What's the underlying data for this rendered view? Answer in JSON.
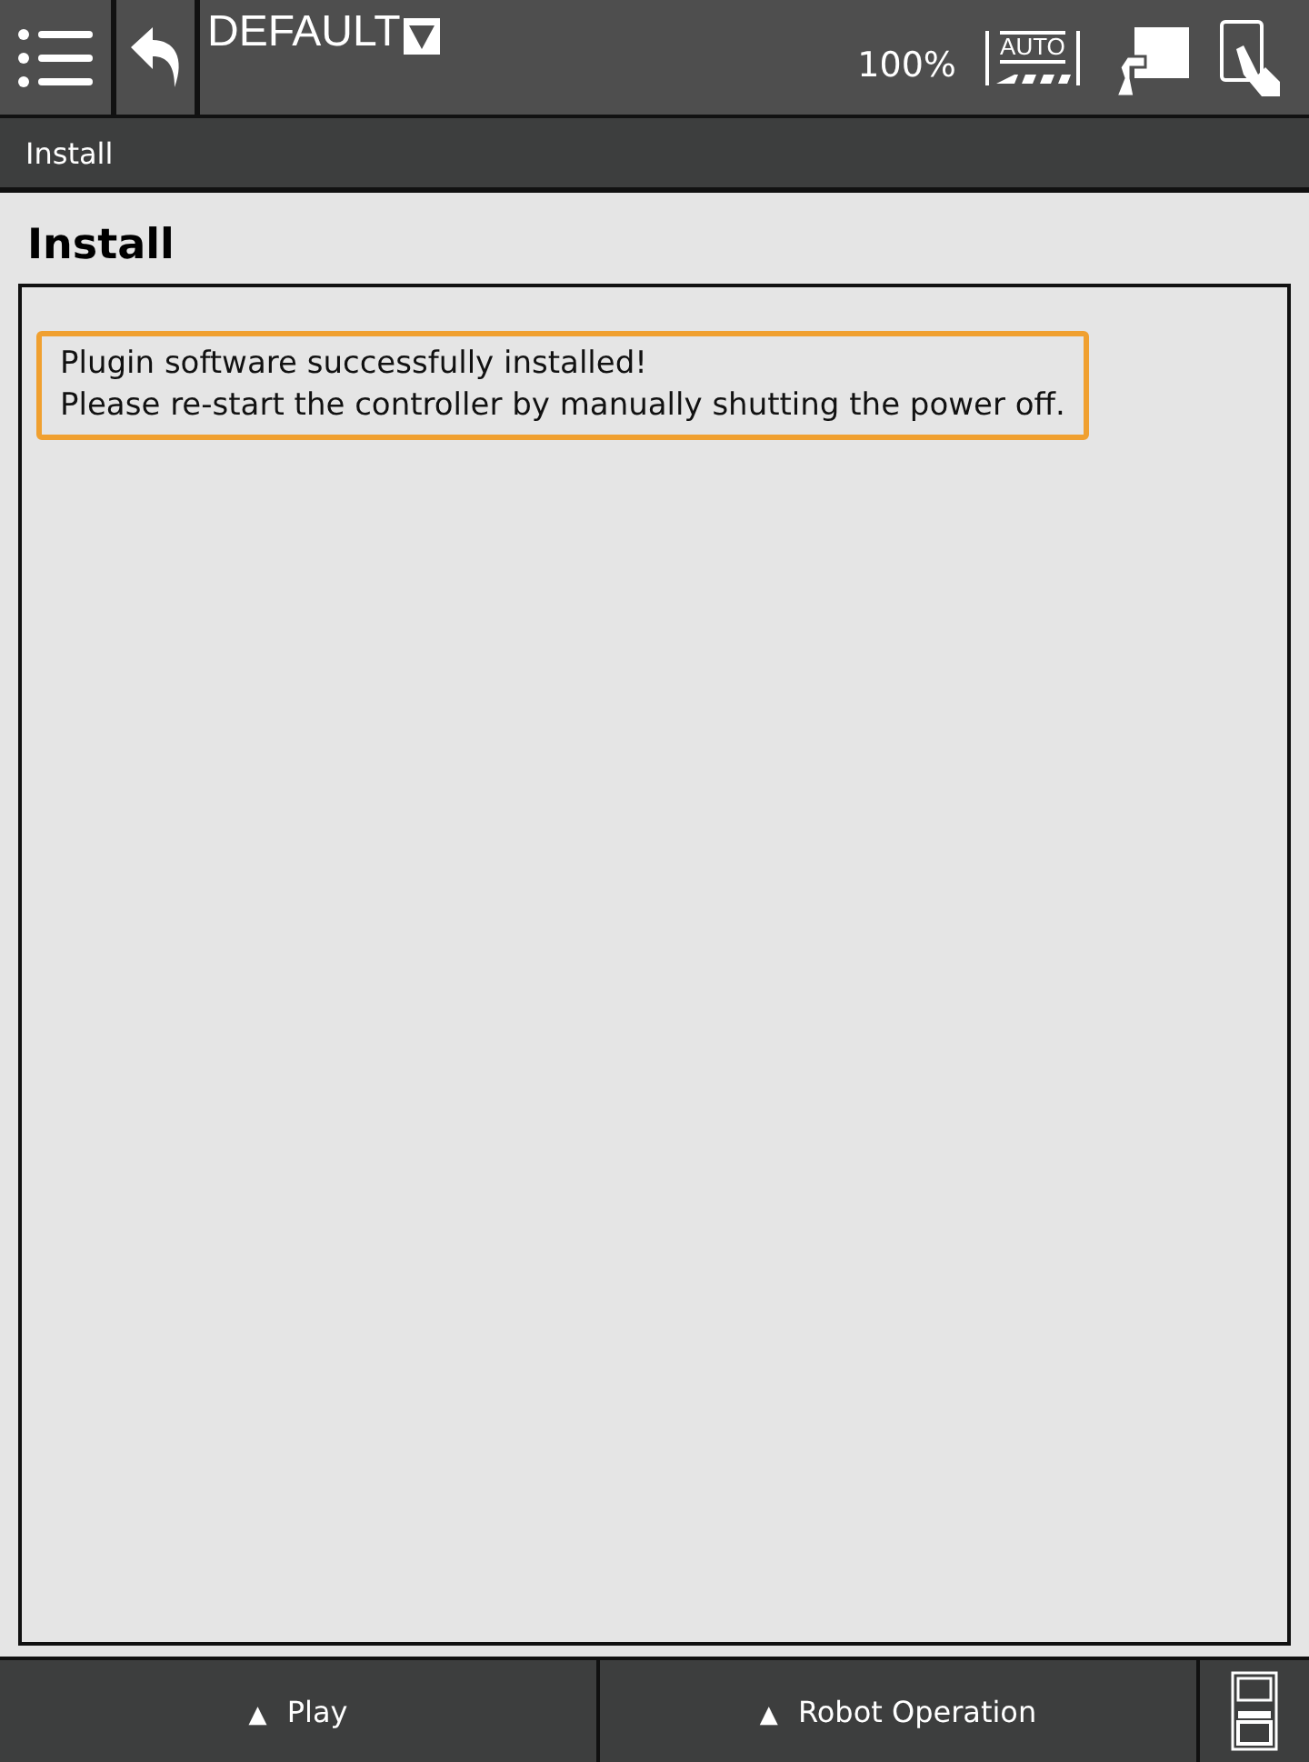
{
  "top_bar": {
    "title": "DEFAULT",
    "speed": "100%",
    "mode_label": "AUTO"
  },
  "breadcrumb": "Install",
  "page": {
    "title": "Install",
    "messages": [
      "Plugin software successfully installed!",
      "Please re-start the controller by manually shutting the power off."
    ]
  },
  "bottom_bar": {
    "buttons": [
      {
        "arrow": "▲",
        "label": "Play"
      },
      {
        "arrow": "▲",
        "label": "Robot Operation"
      }
    ]
  }
}
